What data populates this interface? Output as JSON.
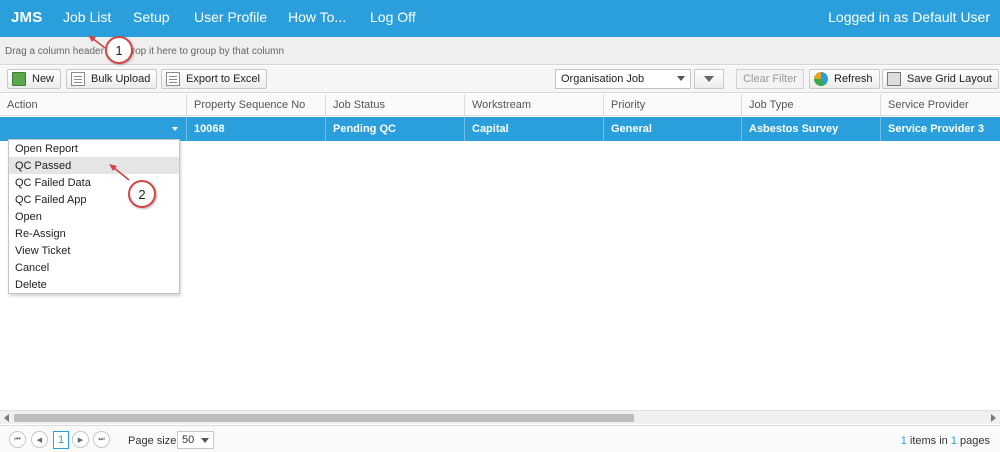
{
  "nav": {
    "brand": "JMS",
    "items": [
      "Job List",
      "Setup",
      "User Profile",
      "How To...",
      "Log Off"
    ],
    "user_text": "Logged in as Default User"
  },
  "group_panel": {
    "hint": "Drag a column header and drop it here to group by that column"
  },
  "toolbar": {
    "new_label": "New",
    "bulk_upload_label": "Bulk Upload",
    "export_label": "Export to Excel",
    "view_select": "Organisation Job",
    "clear_filter_label": "Clear Filter",
    "refresh_label": "Refresh",
    "save_layout_label": "Save Grid Layout"
  },
  "grid": {
    "columns": [
      "Action",
      "Property Sequence No",
      "Job Status",
      "Workstream",
      "Priority",
      "Job Type",
      "Service Provider"
    ],
    "rows": [
      {
        "action": "",
        "property_sequence_no": "10068",
        "job_status": "Pending QC",
        "workstream": "Capital",
        "priority": "General",
        "job_type": "Asbestos Survey",
        "service_provider": "Service Provider 3"
      }
    ]
  },
  "action_menu": {
    "items": [
      "Open Report",
      "QC Passed",
      "QC Failed Data",
      "QC Failed App",
      "Open",
      "Re-Assign",
      "View Ticket",
      "Cancel",
      "Delete"
    ],
    "hovered": "QC Passed"
  },
  "callouts": [
    "1",
    "2"
  ],
  "pager": {
    "current_page": "1",
    "page_size_label": "Page size:",
    "page_size": "50",
    "items_count": "1",
    "items_text": " items in ",
    "pages_count": "1",
    "pages_text": " pages",
    "first_glyph": "⏮",
    "prev_glyph": "◀",
    "next_glyph": "▶",
    "last_glyph": "⏭"
  },
  "colors": {
    "accent": "#2a9fdb",
    "callout_border": "#d24545"
  }
}
